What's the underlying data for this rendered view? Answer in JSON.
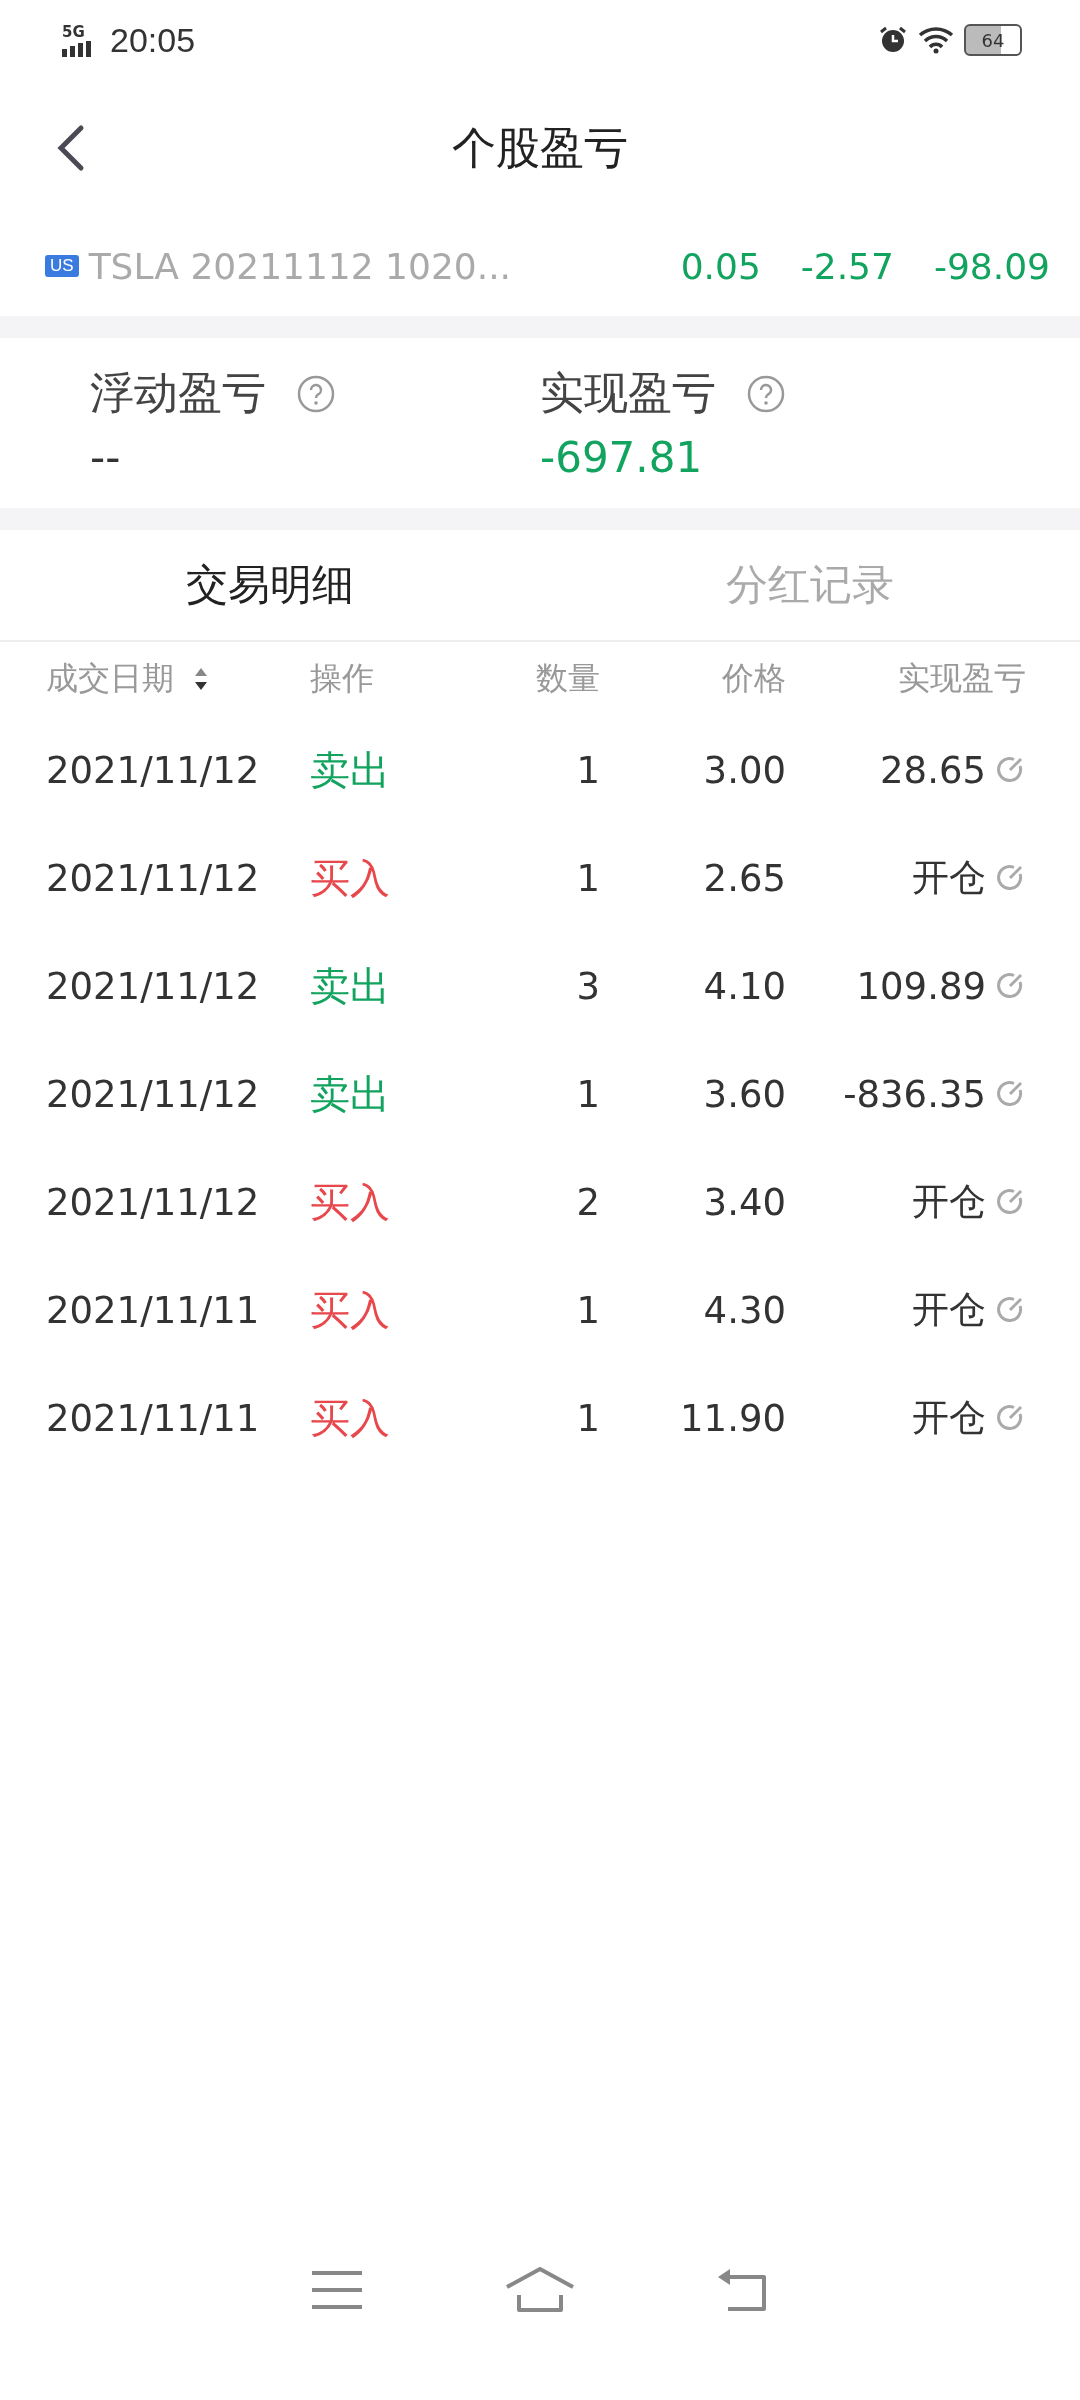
{
  "status_bar": {
    "network": "5G",
    "time": "20:05",
    "battery": "64"
  },
  "header": {
    "title": "个股盈亏"
  },
  "ticker": {
    "market": "US",
    "name": "TSLA 20211112 1020...",
    "values": [
      "0.05",
      "-2.57",
      "-98.09"
    ]
  },
  "summary": [
    {
      "label": "浮动盈亏",
      "value": "--",
      "kind": "neutral"
    },
    {
      "label": "实现盈亏",
      "value": "-697.81",
      "kind": "loss"
    }
  ],
  "tabs": [
    {
      "label": "交易明细",
      "selected": true
    },
    {
      "label": "分红记录",
      "selected": false
    }
  ],
  "table": {
    "columns": [
      "成交日期",
      "操作",
      "数量",
      "价格",
      "实现盈亏"
    ],
    "rows": [
      {
        "date": "2021/11/12",
        "action": "卖出",
        "kind": "sell",
        "quantity": "1",
        "price": "3.00",
        "pnl": "28.65"
      },
      {
        "date": "2021/11/12",
        "action": "买入",
        "kind": "buy",
        "quantity": "1",
        "price": "2.65",
        "pnl": "开仓"
      },
      {
        "date": "2021/11/12",
        "action": "卖出",
        "kind": "sell",
        "quantity": "3",
        "price": "4.10",
        "pnl": "109.89"
      },
      {
        "date": "2021/11/12",
        "action": "卖出",
        "kind": "sell",
        "quantity": "1",
        "price": "3.60",
        "pnl": "-836.35"
      },
      {
        "date": "2021/11/12",
        "action": "买入",
        "kind": "buy",
        "quantity": "2",
        "price": "3.40",
        "pnl": "开仓"
      },
      {
        "date": "2021/11/11",
        "action": "买入",
        "kind": "buy",
        "quantity": "1",
        "price": "4.30",
        "pnl": "开仓"
      },
      {
        "date": "2021/11/11",
        "action": "买入",
        "kind": "buy",
        "quantity": "1",
        "price": "11.90",
        "pnl": "开仓"
      }
    ]
  }
}
